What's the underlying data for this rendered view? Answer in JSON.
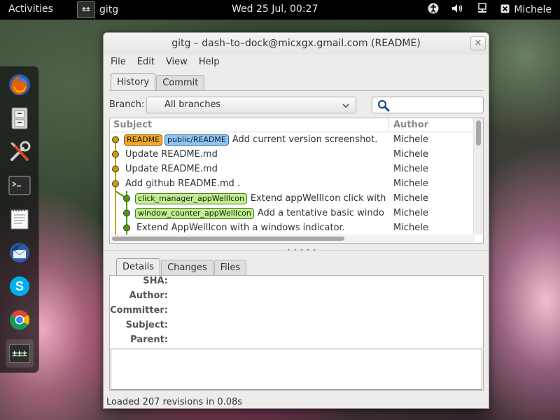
{
  "topbar": {
    "activities": "Activities",
    "app_menu_label": "gitg",
    "app_icon_text": "±±",
    "clock": "Wed 25 Jul, 00:27",
    "user": "Michele",
    "icons": [
      "accessibility-icon",
      "volume-icon",
      "network-icon"
    ]
  },
  "dock": {
    "items": [
      "firefox-icon",
      "file-cabinet-icon",
      "tools-icon",
      "terminal-icon",
      "text-editor-icon",
      "thunderbird-icon",
      "skype-icon",
      "chrome-icon",
      "gitg-icon"
    ],
    "gitg_icon_text": "±±±"
  },
  "window": {
    "title": "gitg – dash–to–dock@micxgx.gmail.com (README)",
    "close": "×",
    "menu": [
      "File",
      "Edit",
      "View",
      "Help"
    ],
    "tabs": [
      "History",
      "Commit"
    ],
    "branch_label": "Branch:",
    "branch_value": "All branches",
    "search_value": ""
  },
  "history": {
    "columns": {
      "subject": "Subject",
      "author": "Author"
    },
    "rows": [
      {
        "badges": [
          {
            "text": "README",
            "color": "orange"
          },
          {
            "text": "public/README",
            "color": "blue"
          }
        ],
        "subject": "Add current version screenshot.",
        "author": "Michele",
        "lane": 0
      },
      {
        "badges": [],
        "subject": "Update README.md",
        "author": "Michele",
        "lane": 0
      },
      {
        "badges": [],
        "subject": "Update README.md",
        "author": "Michele",
        "lane": 0
      },
      {
        "badges": [],
        "subject": "Add github README.md .",
        "author": "Michele",
        "lane": 0
      },
      {
        "badges": [
          {
            "text": "click_manager_appWellIcon",
            "color": "green"
          }
        ],
        "subject": "Extend appWellIcon click with",
        "author": "Michele",
        "lane": 1
      },
      {
        "badges": [
          {
            "text": "window_counter_appWellIcon",
            "color": "green"
          }
        ],
        "subject": "Add a tentative basic windo",
        "author": "Michele",
        "lane": 1
      },
      {
        "badges": [],
        "subject": "Extend AppWellIcon with a windows indicator.",
        "author": "Michele",
        "lane": 1
      }
    ]
  },
  "details": {
    "tabs": [
      "Details",
      "Changes",
      "Files"
    ],
    "labels": [
      "SHA:",
      "Author:",
      "Committer:",
      "Subject:",
      "Parent:"
    ]
  },
  "statusbar": "Loaded 207 revisions in 0.08s",
  "colors": {
    "lane_main": "#c4a000",
    "lane_branch": "#4e9a06",
    "badge_orange": "#f5a623",
    "badge_blue": "#8cc4f2",
    "badge_green": "#c1ef8f"
  }
}
